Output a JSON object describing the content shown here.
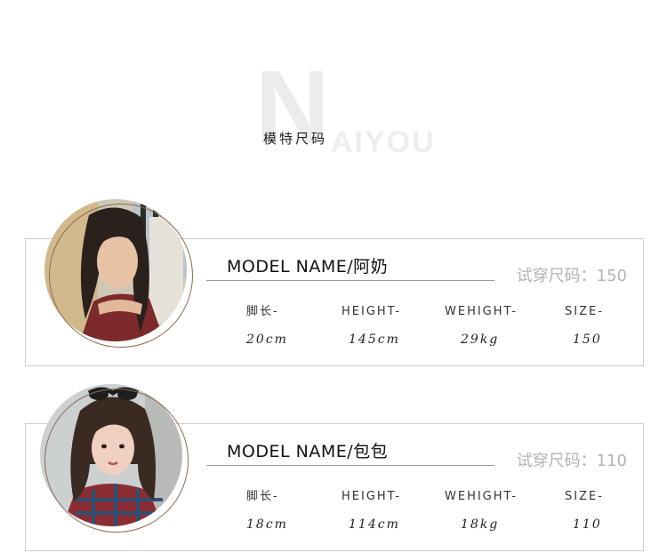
{
  "brand": {
    "initial": "N",
    "rest": "AIYOU"
  },
  "section_title": "模特尺码",
  "models": [
    {
      "name_label": "MODEL NAME/阿奶",
      "size_tag": "试穿尺码：150",
      "labels": [
        "脚长-",
        "HEIGHT-",
        "WEHIGHT-",
        "SIZE-"
      ],
      "values": [
        "20cm",
        "145cm",
        "29kg",
        "150"
      ]
    },
    {
      "name_label": "MODEL NAME/包包",
      "size_tag": "试穿尺码：110",
      "labels": [
        "脚长-",
        "HEIGHT-",
        "WEHIGHT-",
        "SIZE-"
      ],
      "values": [
        "18cm",
        "114cm",
        "18kg",
        "110"
      ]
    }
  ],
  "colors": {
    "ring": "#8a6b55",
    "border": "#cfcfcf",
    "muted_text": "#b3b3b3",
    "watermark": "#ececec"
  }
}
